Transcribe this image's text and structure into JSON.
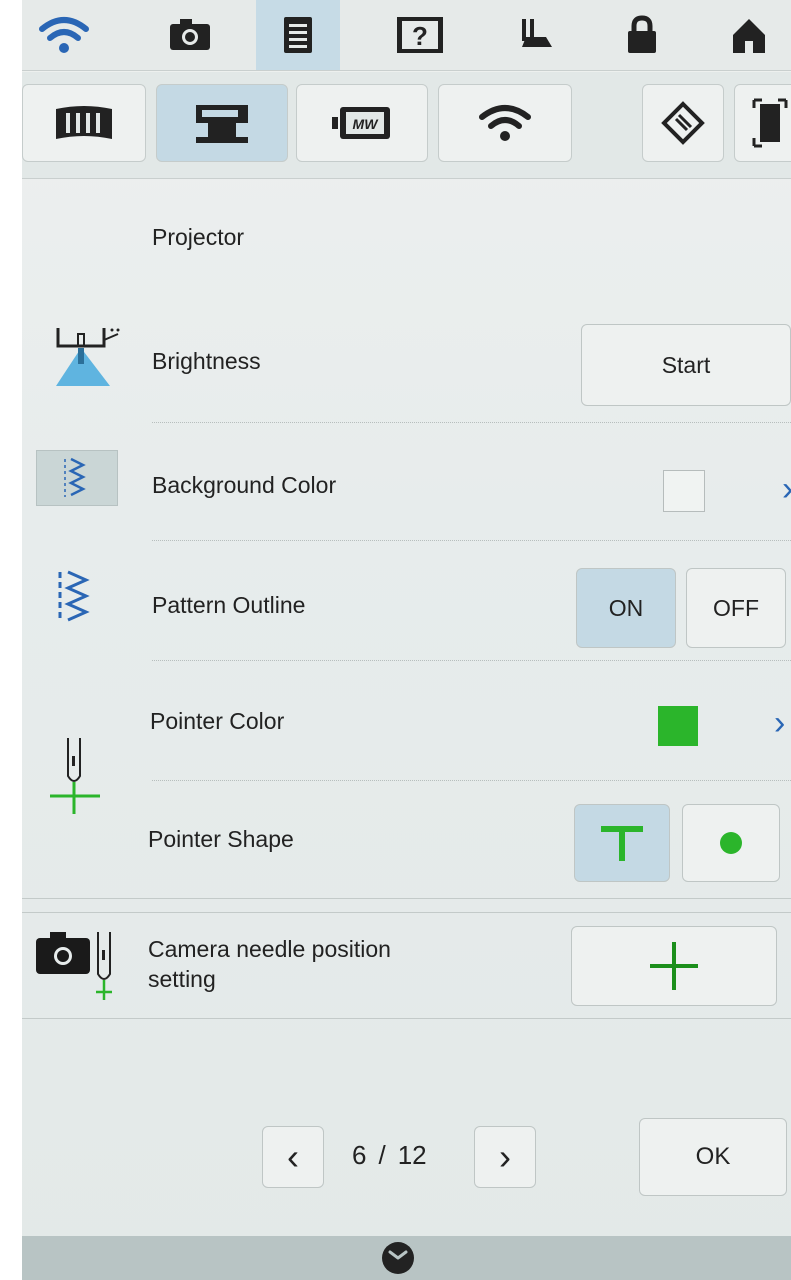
{
  "topbar": {
    "items": [
      {
        "icon": "wifi-icon"
      },
      {
        "icon": "camera-icon"
      },
      {
        "icon": "document-icon",
        "active": true
      },
      {
        "icon": "help-video-icon"
      },
      {
        "icon": "sewing-foot-icon"
      },
      {
        "icon": "lock-icon"
      },
      {
        "icon": "home-icon"
      }
    ]
  },
  "categories": [
    {
      "icon": "embroidery-frame-icon"
    },
    {
      "icon": "sewing-machine-icon",
      "active": true
    },
    {
      "icon": "projector-icon"
    },
    {
      "icon": "wifi-icon"
    },
    {
      "icon": "diamond-icon"
    },
    {
      "icon": "screen-icon"
    }
  ],
  "section": {
    "title": "Projector"
  },
  "rows": {
    "brightness": {
      "label": "Brightness",
      "button": "Start"
    },
    "background_color": {
      "label": "Background Color",
      "swatch": "#f0f3f2"
    },
    "pattern_outline": {
      "label": "Pattern Outline",
      "on": "ON",
      "off": "OFF",
      "selected": "ON"
    },
    "pointer_color": {
      "label": "Pointer Color",
      "swatch": "#2bb52b"
    },
    "pointer_shape": {
      "label": "Pointer Shape",
      "selected": "T-shape"
    },
    "camera": {
      "label_line1": "Camera needle position",
      "label_line2": "setting"
    }
  },
  "pager": {
    "current": "6",
    "separator": "/",
    "total": "12",
    "ok": "OK"
  },
  "colors": {
    "accent": "#2a66b5",
    "active": "#c4d9e4",
    "green": "#2bb52b"
  }
}
